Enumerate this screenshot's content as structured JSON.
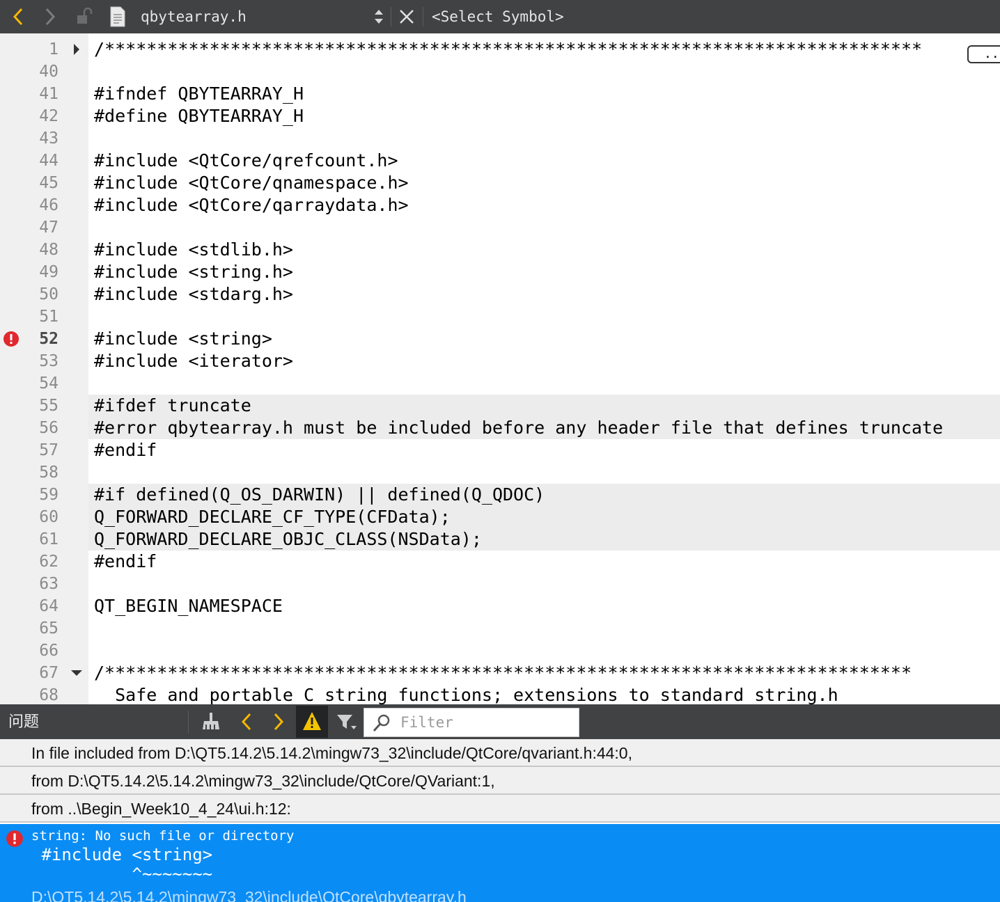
{
  "toolbar": {
    "file_name": "qbytearray.h",
    "symbol_selector": "<Select Symbol>"
  },
  "editor": {
    "lines": [
      {
        "num": "1",
        "code": "/******************************************************************************"
      },
      {
        "num": "40",
        "code": ""
      },
      {
        "num": "41",
        "code": "#ifndef QBYTEARRAY_H"
      },
      {
        "num": "42",
        "code": "#define QBYTEARRAY_H"
      },
      {
        "num": "43",
        "code": ""
      },
      {
        "num": "44",
        "code": "#include <QtCore/qrefcount.h>"
      },
      {
        "num": "45",
        "code": "#include <QtCore/qnamespace.h>"
      },
      {
        "num": "46",
        "code": "#include <QtCore/qarraydata.h>"
      },
      {
        "num": "47",
        "code": ""
      },
      {
        "num": "48",
        "code": "#include <stdlib.h>"
      },
      {
        "num": "49",
        "code": "#include <string.h>"
      },
      {
        "num": "50",
        "code": "#include <stdarg.h>"
      },
      {
        "num": "51",
        "code": ""
      },
      {
        "num": "52",
        "code": "#include <string>"
      },
      {
        "num": "53",
        "code": "#include <iterator>"
      },
      {
        "num": "54",
        "code": ""
      },
      {
        "num": "55",
        "code": "#ifdef truncate"
      },
      {
        "num": "56",
        "code": "#error qbytearray.h must be included before any header file that defines truncate"
      },
      {
        "num": "57",
        "code": "#endif"
      },
      {
        "num": "58",
        "code": ""
      },
      {
        "num": "59",
        "code": "#if defined(Q_OS_DARWIN) || defined(Q_QDOC)"
      },
      {
        "num": "60",
        "code": "Q_FORWARD_DECLARE_CF_TYPE(CFData);"
      },
      {
        "num": "61",
        "code": "Q_FORWARD_DECLARE_OBJC_CLASS(NSData);"
      },
      {
        "num": "62",
        "code": "#endif"
      },
      {
        "num": "63",
        "code": ""
      },
      {
        "num": "64",
        "code": "QT_BEGIN_NAMESPACE"
      },
      {
        "num": "65",
        "code": ""
      },
      {
        "num": "66",
        "code": ""
      },
      {
        "num": "67",
        "code": "/*****************************************************************************"
      },
      {
        "num": "68",
        "code": "  Safe and portable C string functions; extensions to standard string.h"
      }
    ],
    "folded_marker": ".."
  },
  "issues_panel": {
    "title": "问题",
    "filter_placeholder": "Filter",
    "rows": [
      "In file included from D:\\QT5.14.2\\5.14.2\\mingw73_32\\include/QtCore/qvariant.h:44:0,",
      "from D:\\QT5.14.2\\5.14.2\\mingw73_32\\include/QtCore/QVariant:1,",
      "from ..\\Begin_Week10_4_24\\ui.h:12:"
    ],
    "selected": {
      "message": "string: No such file or directory",
      "detail_line1": " #include <string>",
      "detail_line2": "          ^~~~~~~~",
      "path": "D:\\QT5.14.2\\5.14.2\\mingw73_32\\include\\QtCore\\qbytearray.h"
    }
  },
  "colors": {
    "toolbar_bg": "#404244",
    "selected_issue_bg": "#0a8cf5",
    "preprocessor": "#000080",
    "string_comment": "#008000",
    "error_red": "#e0282e"
  }
}
